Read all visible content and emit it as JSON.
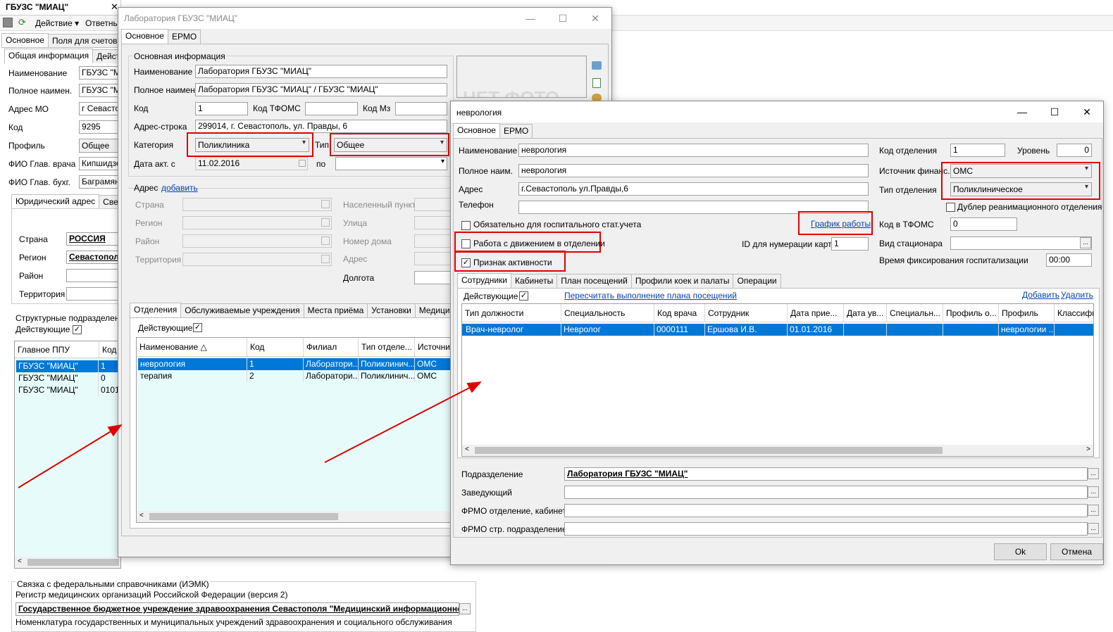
{
  "main": {
    "title": "ГБУЗС \"МИАЦ\"",
    "toolbar": {
      "action_label": "Действие",
      "responsible_label": "Ответны"
    },
    "tabs": [
      "Основное",
      "Поля для счетов"
    ],
    "subtabs": [
      "Общая информация",
      "Действу"
    ],
    "fields": [
      {
        "label": "Наименование",
        "value": "ГБУЗС \"М"
      },
      {
        "label": "Полное наимен.",
        "value": "ГБУЗС \"М"
      },
      {
        "label": "Адрес МО",
        "value": "г Севасто"
      },
      {
        "label": "Код",
        "value": "9295"
      },
      {
        "label": "Профиль",
        "value": "Общее"
      },
      {
        "label": "ФИО Глав. врача",
        "value": "Кипшидзе"
      },
      {
        "label": "ФИО Глав. бухг.",
        "value": "Баграмян"
      }
    ],
    "address_tabs": [
      "Юридический адрес",
      "Сведе"
    ],
    "address": [
      {
        "label": "Страна",
        "value": "РОССИЯ"
      },
      {
        "label": "Регион",
        "value": "Севастопол"
      },
      {
        "label": "Район",
        "value": ""
      },
      {
        "label": "Территория",
        "value": ""
      }
    ],
    "struct_label": "Структурные подразделения",
    "active_label": "Действующие",
    "struct_headers": [
      "Главное ППУ",
      "Код"
    ],
    "struct_rows": [
      [
        "ГБУЗС \"МИАЦ\"",
        "1"
      ],
      [
        "ГБУЗС \"МИАЦ\"",
        "0"
      ],
      [
        "ГБУЗС \"МИАЦ\"",
        "0101"
      ]
    ],
    "federal_label": "Связка с федеральными справочниками (ИЭМК)",
    "registry_label": "Регистр медицинских организаций Российской Федерации (версия 2)",
    "registry_value": "Государственное бюджетное учреждение здравоохранения Севастополя \"Медицинский информационно-а",
    "nomenclature_label": "Номенклатура государственных и муниципальных учреждений здравоохранения и социального обслуживания"
  },
  "lab": {
    "title": "Лаборатория ГБУЗС \"МИАЦ\"",
    "tabs": [
      "Основное",
      "ЕРМО"
    ],
    "section_label": "Основная информация",
    "name_label": "Наименование",
    "name_value": "Лаборатория ГБУЗС \"МИАЦ\"",
    "fullname_label": "Полное наимен.",
    "fullname_value": "Лаборатория ГБУЗС \"МИАЦ\" / ГБУЗС \"МИАЦ\"",
    "code_label": "Код",
    "code_value": "1",
    "tfoms_label": "Код ТФОМС",
    "tfoms_value": "",
    "mz_label": "Код Мз",
    "mz_value": "",
    "addr_label": "Адрес-строка",
    "addr_value": "299014, г. Севастополь, ул. Правды, 6",
    "category_label": "Категория",
    "category_value": "Поликлиника",
    "type_label": "Тип",
    "type_value": "Общее",
    "date_label": "Дата акт. с",
    "date_value": "11.02.2016",
    "to_label": "по",
    "to_value": "",
    "photo_label": "НЕТ ФОТО",
    "address_label": "Адрес",
    "add_link": "добавить",
    "addr_fields_left": [
      "Страна",
      "Регион",
      "Район",
      "Территория"
    ],
    "addr_fields_right": [
      "Населенный пункт",
      "Улица",
      "Номер дома",
      "Адрес",
      "Долгота"
    ],
    "bottom_tabs": [
      "Отделения",
      "Обслуживаемые учреждения",
      "Места приёма",
      "Установки",
      "Медицинские м"
    ],
    "active_label": "Действующие",
    "grid_headers": [
      "Наименование",
      "Код",
      "Филиал",
      "Тип отделе...",
      "Источник"
    ],
    "grid_rows": [
      [
        "неврология",
        "1",
        "Лаборатори...",
        "Поликлинич...",
        "ОМС"
      ],
      [
        "терапия",
        "2",
        "Лаборатори...",
        "Поликлинич...",
        "ОМС"
      ]
    ]
  },
  "dept": {
    "title": "неврология",
    "tabs": [
      "Основное",
      "ЕРМО"
    ],
    "name_label": "Наименование",
    "name_value": "неврология",
    "fullname_label": "Полное наим.",
    "fullname_value": "неврология",
    "addr_label": "Адрес",
    "addr_value": "г.Севастополь ул.Правды,6",
    "phone_label": "Телефон",
    "phone_value": "",
    "dept_code_label": "Код отделения",
    "dept_code_value": "1",
    "level_label": "Уровень",
    "level_value": "0",
    "finance_label": "Источник финанс.",
    "finance_value": "ОМС",
    "dept_type_label": "Тип отделения",
    "dept_type_value": "Поликлиническое",
    "reanim_label": "Дублер реанимационного отделения",
    "hosp_stat_label": "Обязательно для госпитального стат.учета",
    "schedule_link": "График работы",
    "tfoms_label": "Код в ТФОМС",
    "tfoms_value": "0",
    "movement_label": "Работа с движением в отделении",
    "card_id_label": "ID для нумерации карт",
    "card_id_value": "1",
    "stationary_label": "Вид стационара",
    "stationary_value": "",
    "active_sign_label": "Признак активности",
    "hosp_time_label": "Время фиксирования госпитализации",
    "hosp_time_value": "00:00",
    "sub_tabs": [
      "Сотрудники",
      "Кабинеты",
      "План посещений",
      "Профили коек и палаты",
      "Операции"
    ],
    "active_label": "Действующие",
    "recalc_link": "Пересчитать выполнение плана посещений",
    "add_link": "Добавить",
    "delete_link": "Удалить",
    "grid_headers": [
      "Тип должности",
      "Специальность",
      "Код врача",
      "Сотрудник",
      "Дата прие...",
      "Дата ув...",
      "Специальн...",
      "Профиль о...",
      "Профиль",
      "Классифи"
    ],
    "grid_rows": [
      [
        "Врач-невролог",
        "Невролог",
        "0000111",
        "Ершова И.В.",
        "01.01.2016",
        "",
        "",
        "",
        "неврологии ...",
        ""
      ]
    ],
    "subdivision_label": "Подразделение",
    "subdivision_value": "Лаборатория ГБУЗС \"МИАЦ\"",
    "head_label": "Заведующий",
    "head_value": "",
    "frmo_dept_label": "ФРМО отделение, кабинет",
    "frmo_dept_value": "",
    "frmo_sub_label": "ФРМО стр. подразделение",
    "frmo_sub_value": "",
    "ok_label": "Ok",
    "cancel_label": "Отмена"
  }
}
